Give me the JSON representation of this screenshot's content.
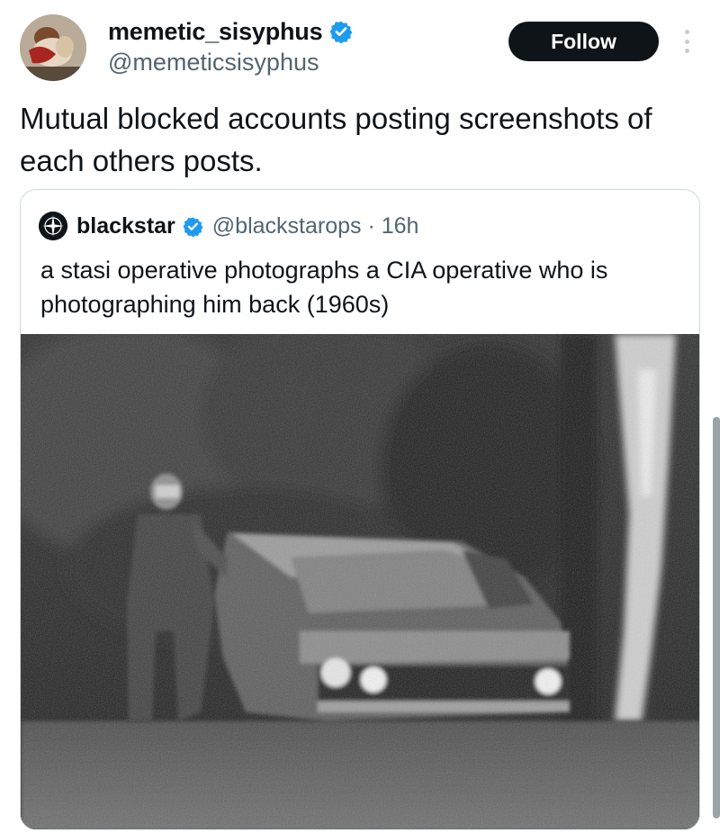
{
  "author": {
    "display_name": "memetic_sisyphus",
    "handle": "@memeticsisyphus",
    "avatar_icon": "painting-avatar-icon",
    "verified_icon": "verified-badge-icon",
    "verified_color": "#1d9bf0"
  },
  "actions": {
    "follow_label": "Follow",
    "more_icon": "vertical-ellipsis-icon"
  },
  "post": {
    "text": "Mutual blocked accounts posting screenshots of each others posts."
  },
  "quoted_post": {
    "display_name": "blackstar",
    "handle_time": "@blackstarops · 16h",
    "avatar_icon": "black-star-logo-icon",
    "text": "a stasi operative photographs a CIA operative who is photographing him back (1960s)",
    "media": {
      "kind": "photo",
      "style": "black-and-white grainy surveillance photograph"
    }
  },
  "colors": {
    "text_primary": "#0f1419",
    "text_secondary": "#536471",
    "follow_button_bg": "#0f1419",
    "border": "#cfd9de"
  }
}
